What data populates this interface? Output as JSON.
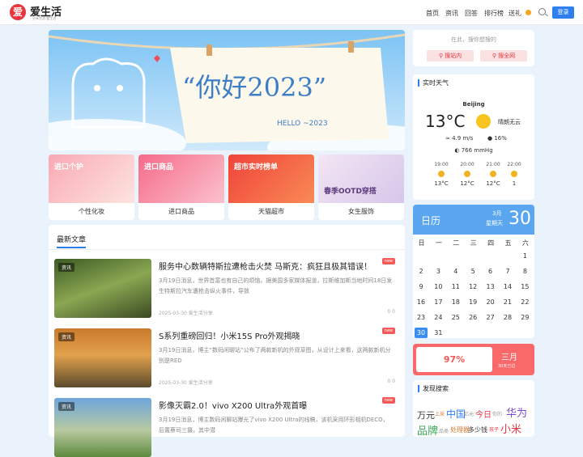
{
  "header": {
    "logo_char": "爱",
    "site_name": "爱生活",
    "slogan": "分享生活·爱生活",
    "nav": [
      "首页",
      "资讯",
      "回答",
      "排行榜",
      "送礼"
    ],
    "login": "登录"
  },
  "banner": {
    "headline": "“你好2023”",
    "subline": "HELLO ~2023"
  },
  "categories": [
    {
      "overlay": "进口个护",
      "label": "个性化妆"
    },
    {
      "overlay": "进口商品",
      "label": "进口商品"
    },
    {
      "overlay": "超市实时榜单",
      "label": "天猫超市"
    },
    {
      "overlay": "春季OOTD穿搭",
      "label": "女生服饰"
    }
  ],
  "articles_title": "最新文章",
  "articles": [
    {
      "tag": "资讯",
      "title": "服务中心数辆特斯拉遭枪击火焚 马斯克：疯狂且极其错误！",
      "desc": "3月19日消息，世界首富也有自己的烦恼。据美国多家媒体报道，拉斯维加斯当地时间18日发生特斯拉汽车遭枪击纵火事件，导致",
      "meta": "2025-03-30 爱生活分享",
      "stats": "0 0",
      "badge": "new"
    },
    {
      "tag": "资讯",
      "title": "S系列重磅回归！小米15S Pro外观揭晓",
      "desc": "3月19日消息，博主“数码闲聊站”公布了两款新机的外观草图，从设计上来看，这两款新机分别是RED",
      "meta": "2025-03-30 爱生活分享",
      "stats": "0 0",
      "badge": "new"
    },
    {
      "tag": "资讯",
      "title": "影像灭霸2.0！vivo X200 Ultra外观首曝",
      "desc": "3月19日消息，博主数码闲聊站曝光了vivo X200 Ultra的线稿，该机采用环形相机DECO，后置蔡司三摄，其中潜",
      "meta": "",
      "stats": "",
      "badge": "new"
    }
  ],
  "search": {
    "placeholder": "在此，搜你想搜的",
    "btn_site": "搜站内",
    "btn_web": "搜全网"
  },
  "weather": {
    "title": "实时天气",
    "city": "Beijing",
    "temp": "13°C",
    "condition": "晴朗无云",
    "wind": "4.9 m/s",
    "humidity": "16%",
    "pressure": "766 mmHg",
    "hours": [
      {
        "time": "19:00",
        "t": "13°C"
      },
      {
        "time": "20:00",
        "t": "12°C"
      },
      {
        "time": "21:00",
        "t": "12°C"
      },
      {
        "time": "22:00",
        "t": "1"
      }
    ]
  },
  "calendar": {
    "title": "日历",
    "month": "3月",
    "weekday": "星期天",
    "day": "30",
    "weekdays": [
      "日",
      "一",
      "二",
      "三",
      "四",
      "五",
      "六"
    ],
    "days": [
      "1",
      "2",
      "3",
      "4",
      "5",
      "6",
      "7",
      "8",
      "9",
      "10",
      "11",
      "12",
      "13",
      "14",
      "15",
      "16",
      "17",
      "18",
      "19",
      "20",
      "21",
      "22",
      "23",
      "24",
      "25",
      "26",
      "27",
      "28",
      "29",
      "30",
      "31"
    ]
  },
  "progress": {
    "percent": "97%",
    "value": 0.97,
    "month": "三月",
    "sub": "30天已过"
  },
  "discover": {
    "title": "发现搜索",
    "words": [
      "万元",
      "上采",
      "中国",
      "亿元",
      "今日",
      "你的",
      "华为",
      "品牌",
      "品类",
      "处理器",
      "多少钱",
      "孩子",
      "小米"
    ]
  },
  "colors": {
    "accent": "#2f7ff0",
    "red": "#e8363f",
    "calendar": "#5aa7f0"
  }
}
